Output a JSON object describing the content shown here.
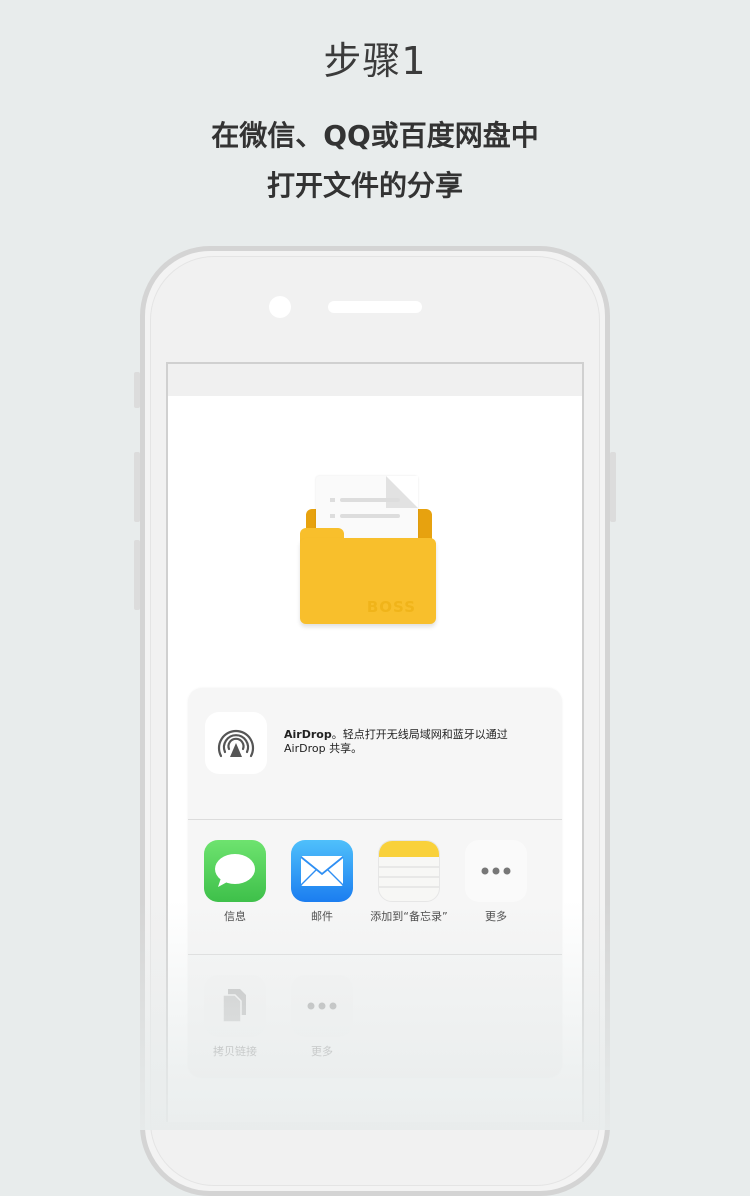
{
  "header": {
    "title": "步骤1",
    "subtitle_line1": "在微信、QQ或百度网盘中",
    "subtitle_line2": "打开文件的分享"
  },
  "file_preview": {
    "folder_brand": "BOSS",
    "icon": "folder-with-document-icon"
  },
  "share_sheet": {
    "airdrop": {
      "icon": "airdrop-icon",
      "title": "AirDrop",
      "description": "。轻点打开无线局域网和蓝牙以通过 AirDrop 共享。"
    },
    "apps": [
      {
        "label": "信息",
        "icon": "messages-icon"
      },
      {
        "label": "邮件",
        "icon": "mail-icon"
      },
      {
        "label": "添加到“备忘录”",
        "icon": "notes-icon"
      },
      {
        "label": "更多",
        "icon": "more-icon"
      }
    ],
    "actions": [
      {
        "label": "拷贝链接",
        "icon": "copy-icon"
      },
      {
        "label": "更多",
        "icon": "more-icon"
      }
    ]
  },
  "colors": {
    "background": "#e8ecec",
    "folder": "#f8bf2c",
    "messages_green": "#4cd964",
    "mail_blue": "#1b7df0"
  }
}
